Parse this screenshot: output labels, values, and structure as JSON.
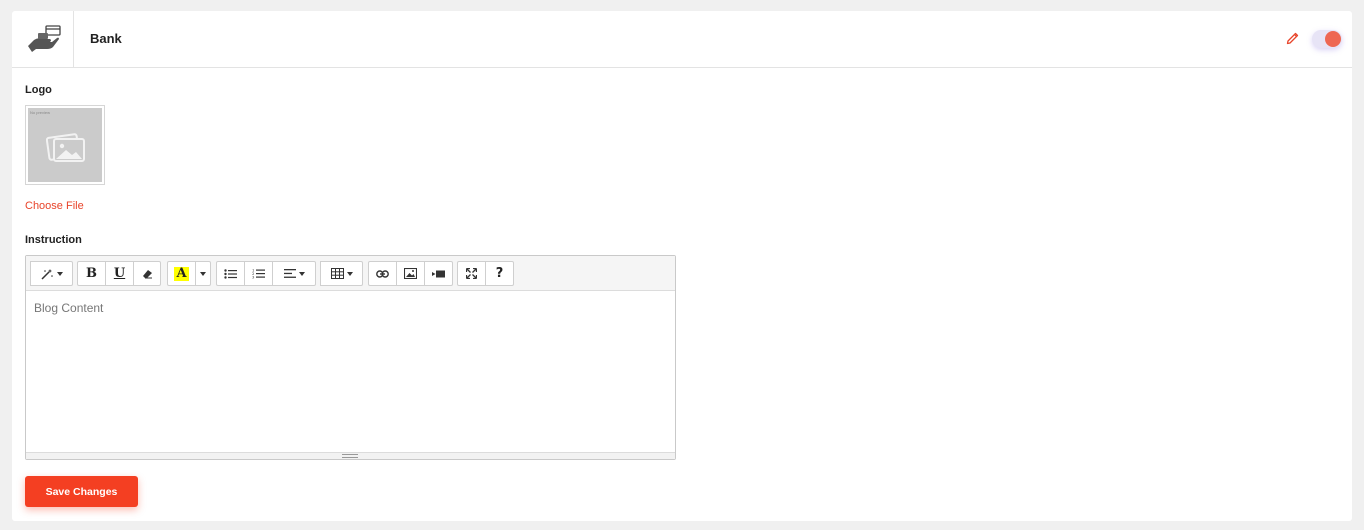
{
  "header": {
    "icon": "bank-card-hand-icon",
    "title": "Bank",
    "enabled": true
  },
  "logo": {
    "label": "Logo",
    "thumbnail_caption": "No preview",
    "choose_file_label": "Choose File"
  },
  "instruction": {
    "label": "Instruction",
    "placeholder": "Blog Content",
    "toolbar": [
      [
        "magic-style-icon"
      ],
      [
        "bold-icon",
        "underline-icon",
        "eraser-icon"
      ],
      [
        "font-color-icon",
        "caret-down-icon"
      ],
      [
        "unordered-list-icon",
        "ordered-list-icon",
        "align-icon"
      ],
      [
        "table-icon"
      ],
      [
        "link-icon",
        "picture-icon",
        "video-icon"
      ],
      [
        "fullscreen-icon",
        "help-icon"
      ]
    ],
    "toolbar_text": {
      "bold": "B",
      "underline": "U",
      "color": "A",
      "help": "?"
    }
  },
  "actions": {
    "save_label": "Save Changes"
  },
  "colors": {
    "accent": "#f43f22",
    "link": "#e8442a",
    "toggle_knob": "#ee6753",
    "toggle_track": "#e7e4f6"
  }
}
